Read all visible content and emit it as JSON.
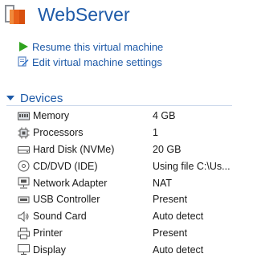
{
  "header": {
    "title": "WebServer",
    "icon": "vm-icon",
    "accent_color": "#e8611a"
  },
  "actions": [
    {
      "label": "Resume this virtual machine",
      "icon": "play-icon"
    },
    {
      "label": "Edit virtual machine settings",
      "icon": "edit-settings-icon"
    }
  ],
  "devices": {
    "label": "Devices",
    "items": [
      {
        "name": "Memory",
        "value": "4 GB",
        "icon": "memory-icon"
      },
      {
        "name": "Processors",
        "value": "1",
        "icon": "processor-icon"
      },
      {
        "name": "Hard Disk (NVMe)",
        "value": "20 GB",
        "icon": "hard-disk-icon"
      },
      {
        "name": "CD/DVD (IDE)",
        "value": "Using file C:\\Us...",
        "icon": "cd-dvd-icon"
      },
      {
        "name": "Network Adapter",
        "value": "NAT",
        "icon": "network-adapter-icon"
      },
      {
        "name": "USB Controller",
        "value": "Present",
        "icon": "usb-icon"
      },
      {
        "name": "Sound Card",
        "value": "Auto detect",
        "icon": "sound-card-icon"
      },
      {
        "name": "Printer",
        "value": "Present",
        "icon": "printer-icon"
      },
      {
        "name": "Display",
        "value": "Auto detect",
        "icon": "display-icon"
      }
    ]
  }
}
